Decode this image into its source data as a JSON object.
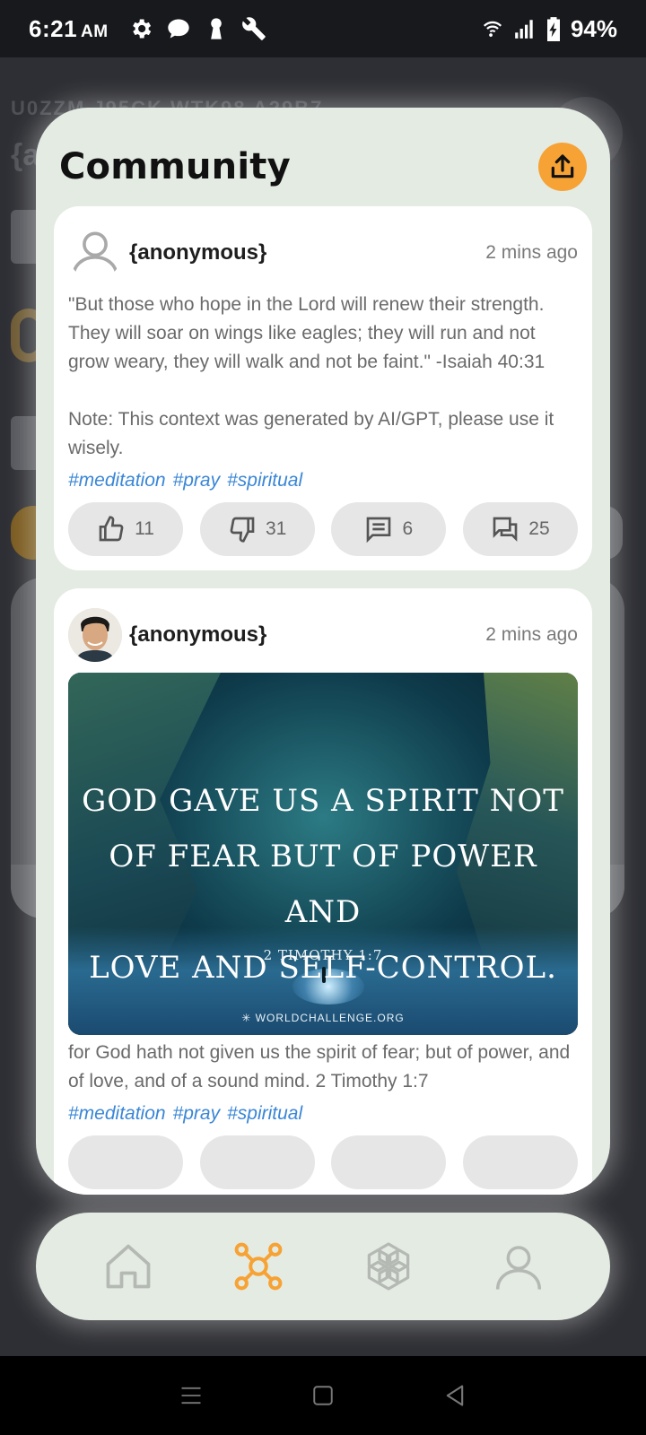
{
  "status_bar": {
    "time": "6:21",
    "ampm": "AM",
    "battery": "94%"
  },
  "background": {
    "code_text": "U0ZZM J95CK WTK98 A29B7",
    "name_text": "{ar"
  },
  "community": {
    "title": "Community",
    "posts": [
      {
        "user": "{anonymous}",
        "time": "2 mins ago",
        "text": "\"But those who hope in the Lord will renew their strength. They will soar on wings like eagles; they will run and not grow weary, they will walk and not be faint.\" -Isaiah 40:31\n\nNote: This context was generated by AI/GPT, please use it wisely.",
        "tags": [
          "#meditation",
          "#pray",
          "#spiritual"
        ],
        "likes": "11",
        "dislikes": "31",
        "comments": "6",
        "discussions": "25"
      },
      {
        "user": "{anonymous}",
        "time": "2 mins ago",
        "image": {
          "quote_line1": "GOD GAVE US A SPIRIT NOT",
          "quote_line2": "OF FEAR BUT OF POWER AND",
          "quote_line3": "LOVE AND SELF-CONTROL.",
          "reference": "2 TIMOTHY 1:7",
          "site": "WORLDCHALLENGE.ORG"
        },
        "text": "for God hath not given us the spirit of fear; but of power, and of love, and of a sound mind. 2 Timothy 1:7",
        "tags": [
          "#meditation",
          "#pray",
          "#spiritual"
        ]
      }
    ]
  },
  "bottom_nav": {
    "items": [
      "home-icon",
      "community-icon",
      "ai-chat-icon",
      "profile-icon"
    ],
    "active": "community-icon"
  },
  "colors": {
    "accent": "#f6a235",
    "tag": "#3a86d6",
    "panel": "#e4ebe3"
  }
}
